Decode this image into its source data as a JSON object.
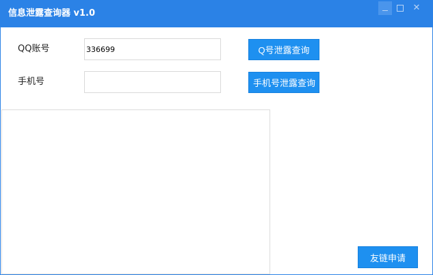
{
  "window": {
    "title": "信息泄露查询器 v1.0",
    "controls": {
      "minimize": "minimize",
      "maximize": "maximize",
      "close": "✕"
    },
    "accent_color": "#2b82e6"
  },
  "form": {
    "qq": {
      "label": "QQ账号",
      "value": "336699",
      "placeholder": ""
    },
    "phone": {
      "label": "手机号",
      "value": "",
      "placeholder": ""
    }
  },
  "buttons": {
    "qq_query": "Q号泄露查询",
    "phone_query": "手机号泄露查询",
    "friend_link": "友链申请",
    "color": "#1e90f0"
  },
  "output": {
    "text": ""
  }
}
